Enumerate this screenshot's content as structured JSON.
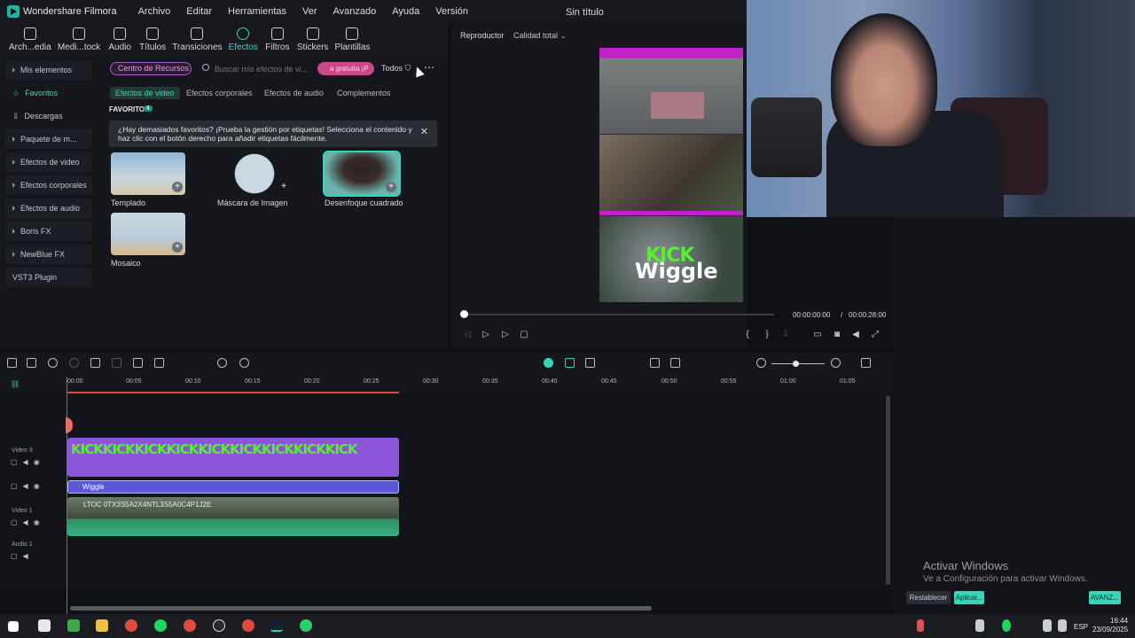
{
  "app": {
    "name": "Wondershare Filmora",
    "doc_title": "Sin título"
  },
  "menu": [
    "Archivo",
    "Editar",
    "Herramientas",
    "Ver",
    "Avanzado",
    "Ayuda",
    "Versión"
  ],
  "toolbar": [
    {
      "label": "Arch...edia",
      "icon": "folder-media-icon"
    },
    {
      "label": "Medi...tock",
      "icon": "stock-media-icon"
    },
    {
      "label": "Audio",
      "icon": "music-note-icon"
    },
    {
      "label": "Títulos",
      "icon": "text-icon"
    },
    {
      "label": "Transiciones",
      "icon": "transition-icon"
    },
    {
      "label": "Efectos",
      "icon": "effects-icon",
      "active": true
    },
    {
      "label": "Filtros",
      "icon": "filter-icon"
    },
    {
      "label": "Stickers",
      "icon": "sticker-icon"
    },
    {
      "label": "Plantillas",
      "icon": "template-icon"
    }
  ],
  "leftnav": [
    {
      "label": "Mis elementos",
      "type": "group"
    },
    {
      "label": "Favoritos",
      "type": "selected"
    },
    {
      "label": "Descargas",
      "type": "item"
    },
    {
      "label": "Paquete de m...",
      "type": "group"
    },
    {
      "label": "Efectos de video",
      "type": "group"
    },
    {
      "label": "Efectos corporales",
      "type": "group"
    },
    {
      "label": "Efectos de audio",
      "type": "group"
    },
    {
      "label": "Boris FX",
      "type": "group"
    },
    {
      "label": "NewBlue FX",
      "type": "group"
    },
    {
      "label": "VST3 Plugin",
      "type": "item"
    }
  ],
  "library": {
    "resource_btn": "Centro de Recursos",
    "search_placeholder": "Buscar mis efectos de vi...",
    "promo": "a gratuita ¡P",
    "filter": "Todos",
    "tabs": [
      "Efectos de video",
      "Efectos corporales",
      "Efectos de audio",
      "Complementos"
    ],
    "fav_label": "FAVORITOS",
    "fav_count": "4",
    "tip": "¿Hay demasiados favoritos? ¡Prueba la gestión por etiquetas! Selecciona el contenido y haz clic con el botón derecho para añadir etiquetas fácilmente.",
    "cards": [
      "Templado",
      "Máscara de Imagen",
      "Desenfoque cuadrado",
      "Mosaico"
    ]
  },
  "player": {
    "header": "Reproductor",
    "quality": "Calidad total",
    "overlay_kick": "KICK",
    "overlay_wiggle": "Wiggle",
    "time_current": "00:00:00:00",
    "time_sep": "/",
    "time_total": "00:00:28:00",
    "progress": 0
  },
  "ruler": [
    "00:00",
    "00:05",
    "00:10",
    "00:15",
    "00:20",
    "00:25",
    "00:30",
    "00:35",
    "00:40",
    "00:45",
    "00:50",
    "00:55",
    "01:00",
    "01:05"
  ],
  "tracks": {
    "video3": "Video 3",
    "video1": "Video 1",
    "audio1": "Audio 1",
    "kick_clip": "KICKKICKKICKKICKKICKKICKKICKKICKKICK",
    "wiggle_clip": "Wiggle",
    "video_clip": "LTOC 0TX3S5A2X4NTL3S5A0C4P1J2E"
  },
  "windows_activation": {
    "title": "Activar Windows",
    "subtitle": "Ve a Configuración para activar Windows."
  },
  "panel_buttons": {
    "reset": "Restablecer",
    "apply": "Aplicar...",
    "advanced": "AVANZ..."
  },
  "taskbar": {
    "lang": "ESP",
    "time": "16:44",
    "date": "23/09/2025"
  },
  "colors": {
    "accent": "#35d7b8",
    "kick_green": "#55f12c",
    "title_clip": "#5a58d8",
    "effect_clip": "#8a55d8",
    "playhead": "#e04848"
  }
}
